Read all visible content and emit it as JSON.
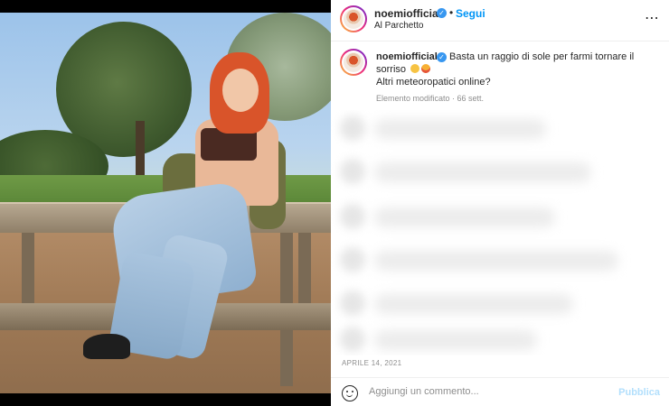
{
  "post": {
    "username": "noemiofficial",
    "verified": true,
    "follow_label": "Segui",
    "separator": "•",
    "location": "Al Parchetto",
    "more_icon": "⋯"
  },
  "caption": {
    "username": "noemiofficial",
    "line1": "Basta un raggio di sole per farmi tornare il",
    "line2": "sorriso",
    "emojis": [
      "smiling-face-emoji",
      "grinning-face-emoji"
    ],
    "line3": "Altri meteoropatici online?",
    "edited": "Elemento modificato · 66 sett."
  },
  "date": "APRILE 14, 2021",
  "comment": {
    "placeholder": "Aggiungi un commento...",
    "publish_label": "Pubblica"
  },
  "colors": {
    "link_blue": "#0095f6",
    "verified_blue": "#3897f0",
    "publish_disabled": "#b2dffc"
  }
}
